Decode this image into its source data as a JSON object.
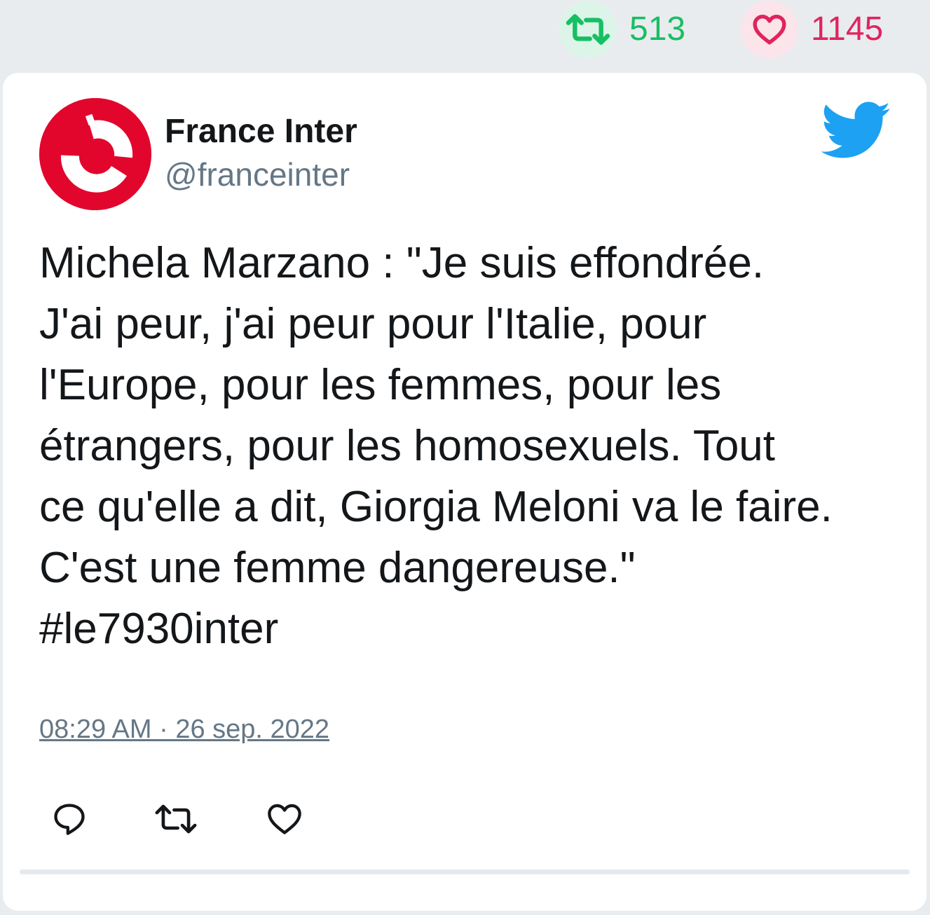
{
  "stats": {
    "retweets": "513",
    "likes": "1145",
    "retweet_icon": "retweet-icon",
    "like_icon": "heart-icon"
  },
  "tweet": {
    "display_name": "France Inter",
    "handle": "@franceinter",
    "text_lines": [
      "Michela Marzano : \"Je suis effondrée.",
      "J'ai peur, j'ai peur pour l'Italie, pour",
      "l'Europe, pour les femmes, pour les",
      "étrangers, pour les homosexuels. Tout",
      "ce qu'elle a dit, Giorgia Meloni va le faire.",
      "C'est une femme dangereuse.\"",
      "#le7930inter"
    ],
    "timestamp": "08:29 AM · 26 sep. 2022"
  },
  "actions": {
    "reply_icon": "reply-icon",
    "retweet_icon": "retweet-icon",
    "like_icon": "heart-icon"
  },
  "colors": {
    "retweet_green": "#17bf63",
    "like_red": "#e0245e",
    "twitter_blue": "#1da1f2",
    "avatar_red": "#e2062d",
    "muted_gray": "#657786"
  }
}
